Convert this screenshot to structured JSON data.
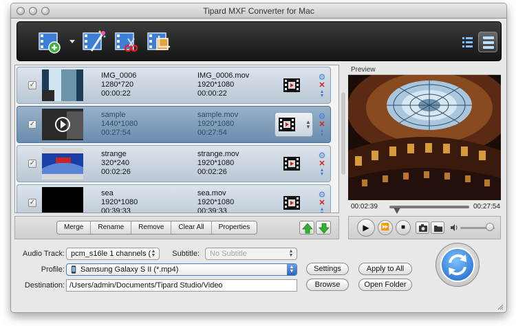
{
  "window": {
    "title": "Tipard MXF Converter for Mac"
  },
  "toolbar": {
    "buttons": [
      {
        "name": "add-file-icon"
      },
      {
        "name": "edit-effect-icon"
      },
      {
        "name": "trim-clip-icon"
      },
      {
        "name": "crop-icon"
      }
    ],
    "views": [
      {
        "name": "list-view-icon",
        "active": false
      },
      {
        "name": "grid-view-icon",
        "active": true
      }
    ]
  },
  "files": [
    {
      "checked": true,
      "selected": false,
      "name": "IMG_0006",
      "resolution": "1280*720",
      "duration": "00:00:22",
      "out_name": "IMG_0006.mov",
      "out_resolution": "1920*1080",
      "out_duration": "00:00:22",
      "thumb": "blue-white"
    },
    {
      "checked": true,
      "selected": true,
      "name": "sample",
      "resolution": "1440*1080",
      "duration": "00:27:54",
      "out_name": "sample.mov",
      "out_resolution": "1920*1080",
      "out_duration": "00:27:54",
      "thumb": "dark-play"
    },
    {
      "checked": true,
      "selected": false,
      "name": "strange",
      "resolution": "320*240",
      "duration": "00:02:26",
      "out_name": "strange.mov",
      "out_resolution": "1920*1080",
      "out_duration": "00:02:26",
      "thumb": "blue-red"
    },
    {
      "checked": true,
      "selected": false,
      "name": "sea",
      "resolution": "1920*1080",
      "duration": "00:39:33",
      "out_name": "sea.mov",
      "out_resolution": "1920*1080",
      "out_duration": "00:39:33",
      "thumb": "black"
    }
  ],
  "actions": {
    "merge": "Merge",
    "rename": "Rename",
    "remove": "Remove",
    "clear_all": "Clear All",
    "properties": "Properties"
  },
  "preview": {
    "label": "Preview",
    "current_time": "00:02:39",
    "total_time": "00:27:54",
    "position": 0.095,
    "volume": 0.85
  },
  "settings": {
    "audio_track_label": "Audio Track:",
    "audio_track_value": "pcm_s16le 1 channels (",
    "subtitle_label": "Subtitle:",
    "subtitle_value": "No Subtitle",
    "profile_label": "Profile:",
    "profile_value": "Samsung Galaxy S II (*.mp4)",
    "destination_label": "Destination:",
    "destination_value": "/Users/admin/Documents/Tipard Studio/Video",
    "settings_button": "Settings",
    "apply_all_button": "Apply to All",
    "browse_button": "Browse",
    "open_folder_button": "Open Folder"
  },
  "colors": {
    "accent": "#2e64b8",
    "selected_row": "#6b8cad",
    "toolbar": "#141414",
    "remove": "#d21d1d"
  }
}
